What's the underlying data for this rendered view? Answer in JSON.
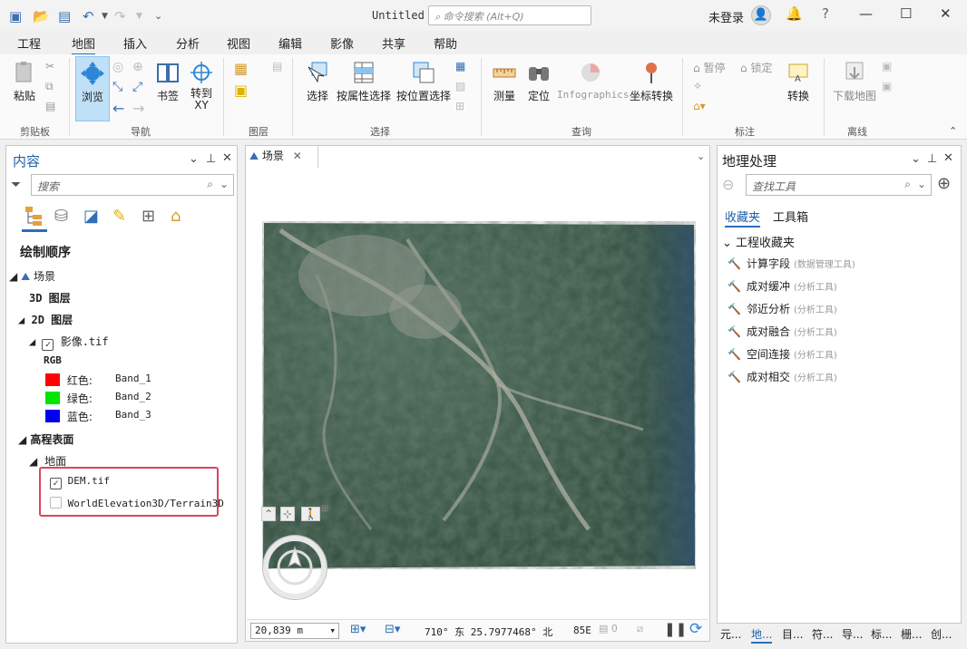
{
  "titlebar": {
    "title": "Untitled",
    "command_search_placeholder": "命令搜索 (Alt+Q)",
    "signin": "未登录",
    "help": "?"
  },
  "ribbon_tabs": [
    "工程",
    "地图",
    "插入",
    "分析",
    "视图",
    "编辑",
    "影像",
    "共享",
    "帮助"
  ],
  "ribbon": {
    "paste": "粘贴",
    "clipboard_group": "剪贴板",
    "explore": "浏览",
    "bookmarks": "书签",
    "goto_xy": "转到\nXY",
    "navigate_group": "导航",
    "layer_group": "图层",
    "select": "选择",
    "select_by_attr": "按属性选择",
    "select_by_loc": "按位置选择",
    "selection_group": "选择",
    "measure": "测量",
    "locate": "定位",
    "infographics": "Infographics",
    "coord_convert": "坐标转换",
    "inquiry_group": "查询",
    "pause": "暂停",
    "lock": "锁定",
    "convert": "转换",
    "labeling_group": "标注",
    "download_map": "下载地图",
    "offline_group": "离线"
  },
  "contents": {
    "title": "内容",
    "search_placeholder": "搜索",
    "drawing_order": "绘制顺序",
    "scene": "场景",
    "layers_3d": "3D 图层",
    "layers_2d": "2D 图层",
    "raster": "影像.tif",
    "rgb": "RGB",
    "bands": [
      {
        "label": "红色:",
        "band": "Band_1",
        "color": "#ff0000"
      },
      {
        "label": "绿色:",
        "band": "Band_2",
        "color": "#00e600"
      },
      {
        "label": "蓝色:",
        "band": "Band_3",
        "color": "#0000ee"
      }
    ],
    "elevation_surfaces": "高程表面",
    "ground": "地面",
    "dem": "DEM.tif",
    "world_elev": "WorldElevation3D/Terrain3D"
  },
  "map": {
    "tab": "场景",
    "scale": "20,839 m",
    "coords": "710° 东 25.7977468° 北",
    "extra": "85E",
    "sel_count": "0"
  },
  "geoprocessing": {
    "title": "地理处理",
    "search_placeholder": "查找工具",
    "tab_favorites": "收藏夹",
    "tab_toolboxes": "工具箱",
    "project_favorites": "工程收藏夹",
    "tools": [
      {
        "name": "计算字段",
        "cat": "(数据管理工具)"
      },
      {
        "name": "成对缓冲",
        "cat": "(分析工具)"
      },
      {
        "name": "邻近分析",
        "cat": "(分析工具)"
      },
      {
        "name": "成对融合",
        "cat": "(分析工具)"
      },
      {
        "name": "空间连接",
        "cat": "(分析工具)"
      },
      {
        "name": "成对相交",
        "cat": "(分析工具)"
      }
    ]
  },
  "bottom_tabs": [
    "元...",
    "地...",
    "目...",
    "符...",
    "导...",
    "标...",
    "栅...",
    "创..."
  ]
}
